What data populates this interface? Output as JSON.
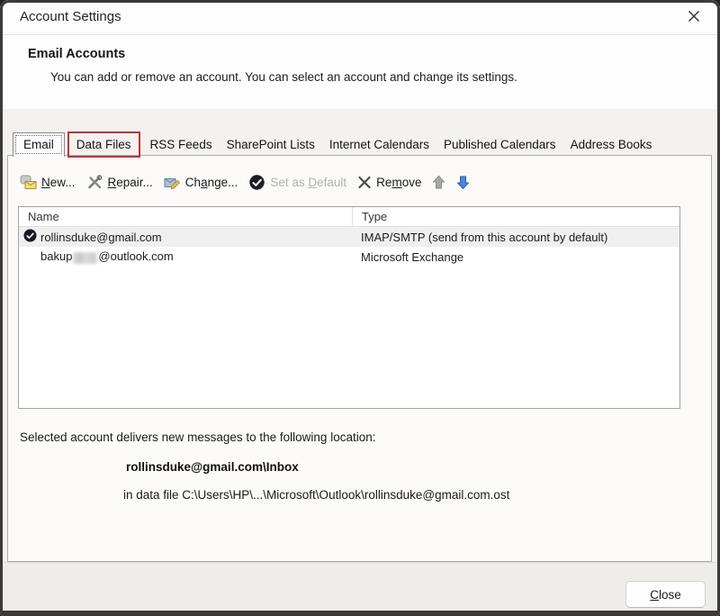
{
  "window": {
    "title": "Account Settings"
  },
  "header": {
    "title": "Email Accounts",
    "description": "You can add or remove an account. You can select an account and change its settings."
  },
  "tabs": {
    "email": "Email",
    "data_files": "Data Files",
    "rss_feeds": "RSS Feeds",
    "sharepoint_lists": "SharePoint Lists",
    "internet_calendars": "Internet Calendars",
    "published_calendars": "Published Calendars",
    "address_books": "Address Books"
  },
  "toolbar": {
    "new": {
      "pre": "",
      "key": "N",
      "post": "ew..."
    },
    "repair": {
      "pre": "",
      "key": "R",
      "post": "epair..."
    },
    "change": {
      "pre": "Ch",
      "key": "a",
      "post": "nge..."
    },
    "set_default": {
      "pre": "Set as ",
      "key": "D",
      "post": "efault",
      "disabled": true
    },
    "remove": {
      "pre": "Re",
      "key": "m",
      "post": "ove"
    }
  },
  "table": {
    "columns": {
      "name": "Name",
      "type": "Type"
    },
    "rows": [
      {
        "name": "rollinsduke@gmail.com",
        "type": "IMAP/SMTP (send from this account by default)",
        "is_default": true,
        "selected": true
      },
      {
        "name_pre": "bakup",
        "name_redacted": true,
        "name_post": "@outlook.com",
        "type": "Microsoft Exchange"
      }
    ]
  },
  "details": {
    "line1": "Selected account delivers new messages to the following location:",
    "location": "rollinsduke@gmail.com\\Inbox",
    "datafile": "in data file C:\\Users\\HP\\...\\Microsoft\\Outlook\\rollinsduke@gmail.com.ost"
  },
  "footer": {
    "close": {
      "pre": "",
      "key": "C",
      "post": "lose"
    }
  },
  "colors": {
    "annotation_red": "#bf323b",
    "down_arrow_blue": "#4e86d8",
    "disabled_gray": "#b5b2ae",
    "selected_row": "#efefef",
    "titlebar_bg": "#fdfdfd",
    "body_bg": "#f4f2ef"
  }
}
